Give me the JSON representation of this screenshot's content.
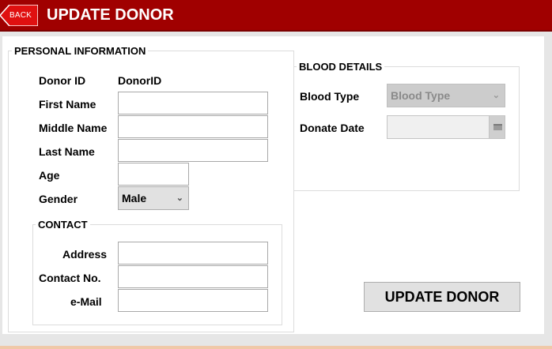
{
  "header": {
    "back_label": "BACK",
    "title": "UPDATE DONOR",
    "color": "#a00000"
  },
  "personal": {
    "legend": "PERSONAL INFORMATION",
    "donor_id_label": "Donor ID",
    "donor_id_value": "DonorID",
    "first_name_label": "First Name",
    "first_name_value": "",
    "middle_name_label": "Middle Name",
    "middle_name_value": "",
    "last_name_label": "Last Name",
    "last_name_value": "",
    "age_label": "Age",
    "age_value": "",
    "gender_label": "Gender",
    "gender_value": "Male"
  },
  "contact": {
    "legend": "CONTACT",
    "address_label": "Address",
    "address_value": "",
    "contact_label": "Contact No.",
    "contact_value": "",
    "email_label": "e-Mail",
    "email_value": ""
  },
  "blood": {
    "legend": "BLOOD DETAILS",
    "type_label": "Blood Type",
    "type_value": "Blood Type",
    "date_label": "Donate Date",
    "date_value": "",
    "icons": {
      "dropdown": "chevron-down-icon",
      "calendar": "calendar-icon"
    }
  },
  "actions": {
    "update_label": "UPDATE DONOR"
  }
}
